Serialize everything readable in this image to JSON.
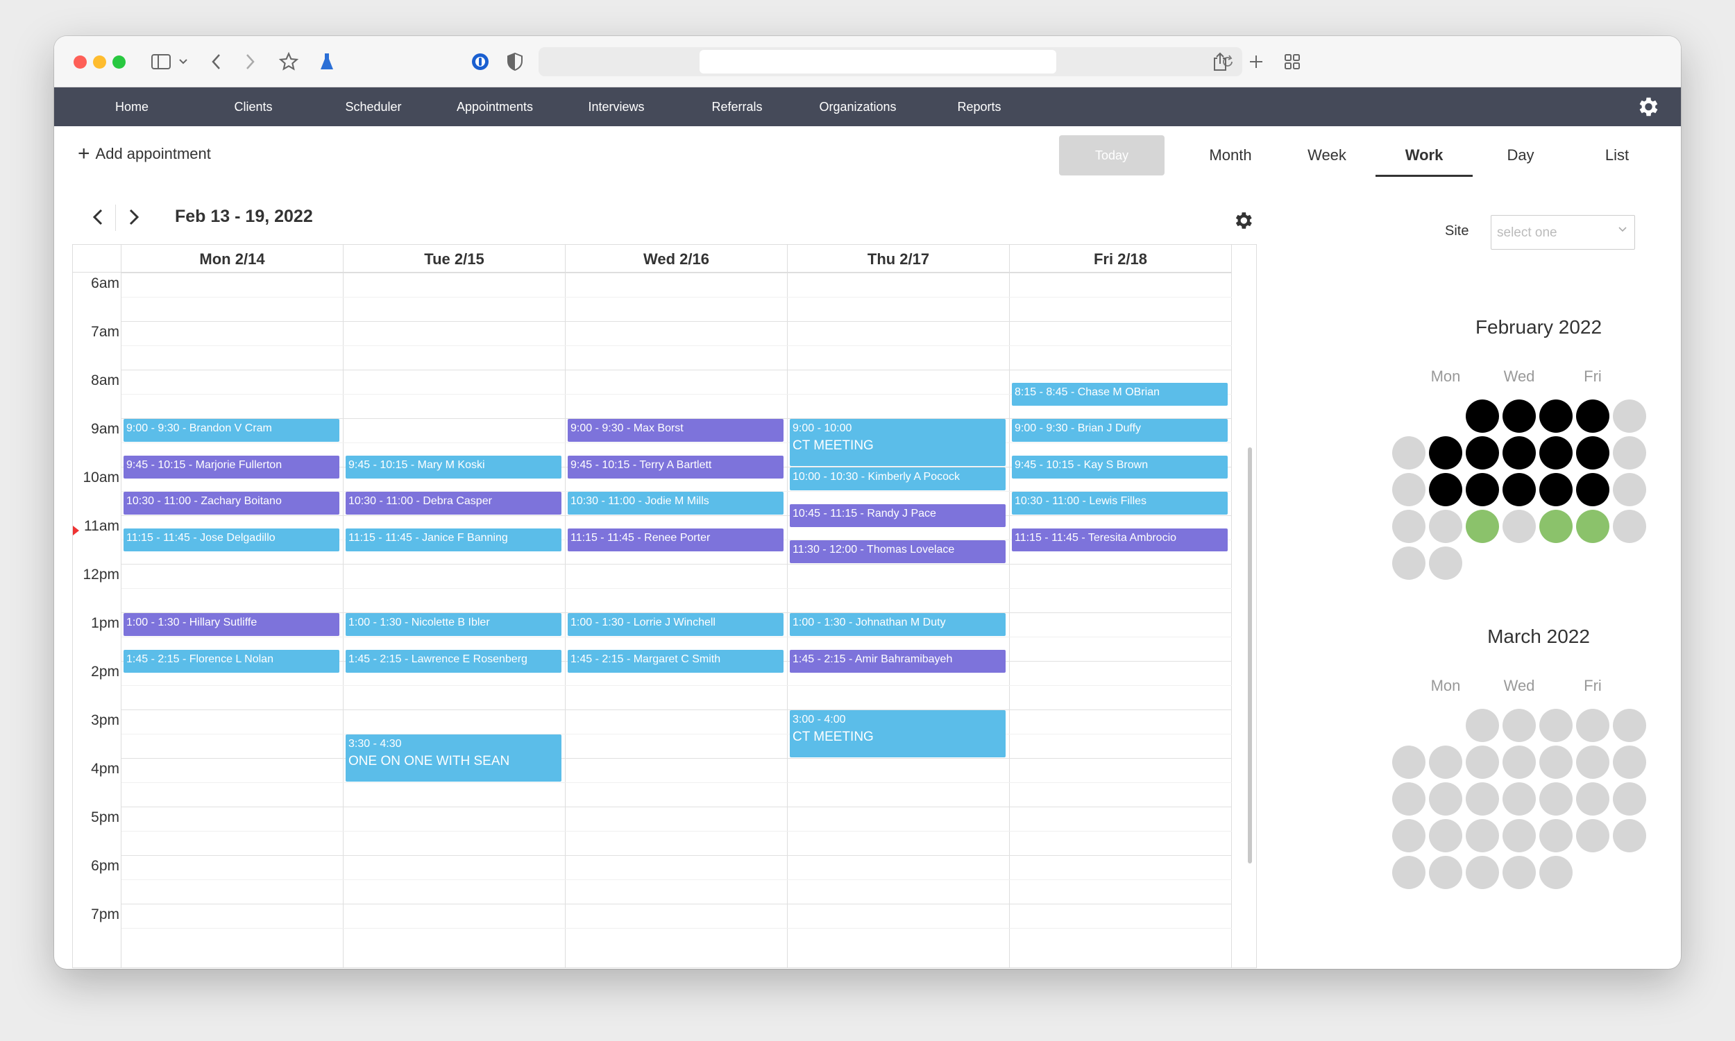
{
  "nav": {
    "items": [
      "Home",
      "Clients",
      "Scheduler",
      "Appointments",
      "Interviews",
      "Referrals",
      "Organizations",
      "Reports"
    ]
  },
  "toolbar": {
    "add_label": "Add appointment",
    "today_label": "Today",
    "views": [
      "Month",
      "Week",
      "Work",
      "Day",
      "List"
    ],
    "active_view": "Work"
  },
  "range": {
    "title": "Feb 13 - 19, 2022"
  },
  "calendar": {
    "days": [
      "Mon 2/14",
      "Tue 2/15",
      "Wed 2/16",
      "Thu 2/17",
      "Fri 2/18"
    ],
    "hours": [
      "6am",
      "7am",
      "8am",
      "9am",
      "10am",
      "11am",
      "12pm",
      "1pm",
      "2pm",
      "3pm",
      "4pm",
      "5pm",
      "6pm",
      "7pm"
    ],
    "events": [
      {
        "day": 0,
        "start": 9.0,
        "end": 9.5,
        "color": "blue",
        "label": "9:00 - 9:30 - Brandon V Cram"
      },
      {
        "day": 0,
        "start": 9.75,
        "end": 10.25,
        "color": "purple",
        "label": "9:45 - 10:15 - Marjorie Fullerton"
      },
      {
        "day": 0,
        "start": 10.5,
        "end": 11.0,
        "color": "purple",
        "label": "10:30 - 11:00 - Zachary Boitano"
      },
      {
        "day": 0,
        "start": 11.25,
        "end": 11.75,
        "color": "blue",
        "label": "11:15 - 11:45 - Jose Delgadillo"
      },
      {
        "day": 0,
        "start": 13.0,
        "end": 13.5,
        "color": "purple",
        "label": "1:00 - 1:30 - Hillary Sutliffe"
      },
      {
        "day": 0,
        "start": 13.75,
        "end": 14.25,
        "color": "blue",
        "label": "1:45 - 2:15 - Florence L Nolan"
      },
      {
        "day": 1,
        "start": 9.75,
        "end": 10.25,
        "color": "blue",
        "label": "9:45 - 10:15 - Mary M Koski"
      },
      {
        "day": 1,
        "start": 10.5,
        "end": 11.0,
        "color": "purple",
        "label": "10:30 - 11:00 - Debra Casper"
      },
      {
        "day": 1,
        "start": 11.25,
        "end": 11.75,
        "color": "blue",
        "label": "11:15 - 11:45 - Janice F Banning"
      },
      {
        "day": 1,
        "start": 13.0,
        "end": 13.5,
        "color": "blue",
        "label": "1:00 - 1:30 - Nicolette B Ibler"
      },
      {
        "day": 1,
        "start": 13.75,
        "end": 14.25,
        "color": "blue",
        "label": "1:45 - 2:15 - Lawrence E Rosenberg"
      },
      {
        "day": 1,
        "start": 15.5,
        "end": 16.5,
        "color": "blue",
        "label": "3:30 - 4:30",
        "title": "ONE ON ONE WITH SEAN"
      },
      {
        "day": 2,
        "start": 9.0,
        "end": 9.5,
        "color": "purple",
        "label": "9:00 - 9:30 - Max Borst"
      },
      {
        "day": 2,
        "start": 9.75,
        "end": 10.25,
        "color": "purple",
        "label": "9:45 - 10:15 - Terry A Bartlett"
      },
      {
        "day": 2,
        "start": 10.5,
        "end": 11.0,
        "color": "blue",
        "label": "10:30 - 11:00 - Jodie M Mills"
      },
      {
        "day": 2,
        "start": 11.25,
        "end": 11.75,
        "color": "purple",
        "label": "11:15 - 11:45 - Renee Porter"
      },
      {
        "day": 2,
        "start": 13.0,
        "end": 13.5,
        "color": "blue",
        "label": "1:00 - 1:30 - Lorrie J Winchell"
      },
      {
        "day": 2,
        "start": 13.75,
        "end": 14.25,
        "color": "blue",
        "label": "1:45 - 2:15 - Margaret C Smith"
      },
      {
        "day": 3,
        "start": 9.0,
        "end": 10.0,
        "color": "blue",
        "label": "9:00 - 10:00",
        "title": "CT MEETING"
      },
      {
        "day": 3,
        "start": 10.0,
        "end": 10.5,
        "color": "blue",
        "label": "10:00 - 10:30 - Kimberly A Pocock"
      },
      {
        "day": 3,
        "start": 10.75,
        "end": 11.25,
        "color": "purple",
        "label": "10:45 - 11:15 - Randy J Pace"
      },
      {
        "day": 3,
        "start": 11.5,
        "end": 12.0,
        "color": "purple",
        "label": "11:30 - 12:00 - Thomas Lovelace"
      },
      {
        "day": 3,
        "start": 13.0,
        "end": 13.5,
        "color": "blue",
        "label": "1:00 - 1:30 - Johnathan M Duty"
      },
      {
        "day": 3,
        "start": 13.75,
        "end": 14.25,
        "color": "purple",
        "label": "1:45 - 2:15 - Amir Bahramibayeh"
      },
      {
        "day": 3,
        "start": 15.0,
        "end": 16.0,
        "color": "blue",
        "label": "3:00 - 4:00",
        "title": "CT MEETING"
      },
      {
        "day": 4,
        "start": 8.25,
        "end": 8.75,
        "color": "blue",
        "label": "8:15 - 8:45 - Chase M OBrian"
      },
      {
        "day": 4,
        "start": 9.0,
        "end": 9.5,
        "color": "blue",
        "label": "9:00 - 9:30 - Brian J Duffy"
      },
      {
        "day": 4,
        "start": 9.75,
        "end": 10.25,
        "color": "blue",
        "label": "9:45 - 10:15 - Kay S Brown"
      },
      {
        "day": 4,
        "start": 10.5,
        "end": 11.0,
        "color": "blue",
        "label": "10:30 - 11:00 - Lewis Filles"
      },
      {
        "day": 4,
        "start": 11.25,
        "end": 11.75,
        "color": "purple",
        "label": "11:15 - 11:45 - Teresita Ambrocio"
      }
    ]
  },
  "site": {
    "label": "Site",
    "placeholder": "select one"
  },
  "mini_calendars": [
    {
      "title": "February 2022",
      "dow": [
        "Mon",
        "Wed",
        "Fri"
      ],
      "rows": [
        [
          null,
          null,
          "black",
          "black",
          "black",
          "black",
          "gray"
        ],
        [
          "gray",
          "black",
          "black",
          "black",
          "black",
          "black",
          "gray"
        ],
        [
          "gray",
          "black",
          "black",
          "black",
          "black",
          "black",
          "gray"
        ],
        [
          "gray",
          "gray",
          "green",
          "gray",
          "green",
          "green",
          "gray"
        ],
        [
          "gray",
          "gray",
          null,
          null,
          null,
          null,
          null
        ]
      ]
    },
    {
      "title": "March 2022",
      "dow": [
        "Mon",
        "Wed",
        "Fri"
      ],
      "rows": [
        [
          null,
          null,
          "gray",
          "gray",
          "gray",
          "gray",
          "gray"
        ],
        [
          "gray",
          "gray",
          "gray",
          "gray",
          "gray",
          "gray",
          "gray"
        ],
        [
          "gray",
          "gray",
          "gray",
          "gray",
          "gray",
          "gray",
          "gray"
        ],
        [
          "gray",
          "gray",
          "gray",
          "gray",
          "gray",
          "gray",
          "gray"
        ],
        [
          "gray",
          "gray",
          "gray",
          "gray",
          "gray",
          null,
          null
        ]
      ]
    }
  ]
}
